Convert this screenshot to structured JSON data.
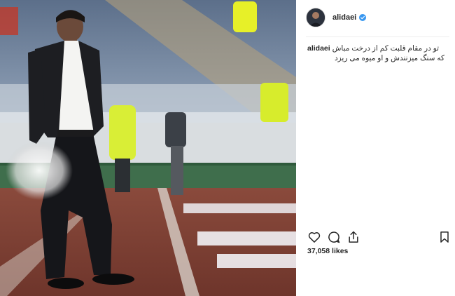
{
  "post": {
    "username": "alidaei",
    "verified": true,
    "caption_user": "alidaei",
    "caption_line1": "تو در مقام قلبت کم از درخت مباش",
    "caption_line2": "که سنگ میزنندش و او میوه می ریزد",
    "likes": "37,058 likes"
  },
  "icons": {
    "like": "heart-icon",
    "comment": "comment-icon",
    "share": "share-icon",
    "save": "bookmark-icon",
    "verified": "verified-badge-icon"
  },
  "colors": {
    "verified_blue": "#3897f0",
    "text": "#262626",
    "border": "#efefef"
  }
}
